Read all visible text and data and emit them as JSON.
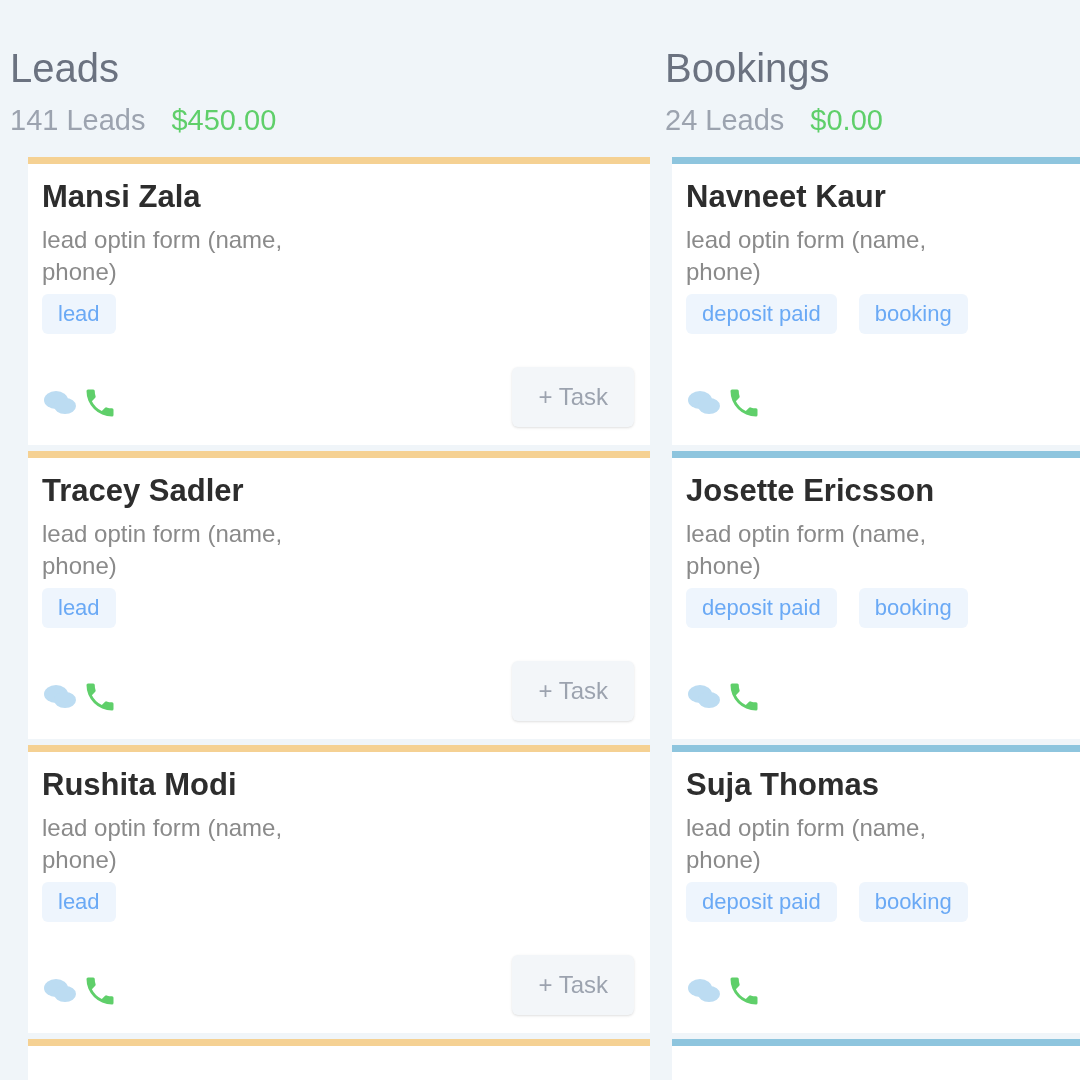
{
  "columns": [
    {
      "title": "Leads",
      "count": "141 Leads",
      "amount": "$450.00",
      "color": "#f5d193",
      "cards": [
        {
          "name": "Mansi Zala",
          "source": "lead optin form (name, phone)",
          "tags": [
            "lead"
          ],
          "task_button": "+ Task"
        },
        {
          "name": "Tracey Sadler",
          "source": "lead optin form (name, phone)",
          "tags": [
            "lead"
          ],
          "task_button": "+ Task"
        },
        {
          "name": "Rushita Modi",
          "source": "lead optin form (name, phone)",
          "tags": [
            "lead"
          ],
          "task_button": "+ Task"
        }
      ]
    },
    {
      "title": "Bookings",
      "count": "24 Leads",
      "amount": "$0.00",
      "color": "#8ec5de",
      "cards": [
        {
          "name": "Navneet Kaur",
          "source": "lead optin form (name, phone)",
          "tags": [
            "deposit paid",
            "booking"
          ]
        },
        {
          "name": "Josette Ericsson",
          "source": "lead optin form (name, phone)",
          "tags": [
            "deposit paid",
            "booking"
          ]
        },
        {
          "name": "Suja Thomas",
          "source": "lead optin form (name, phone)",
          "tags": [
            "deposit paid",
            "booking"
          ]
        }
      ]
    }
  ]
}
